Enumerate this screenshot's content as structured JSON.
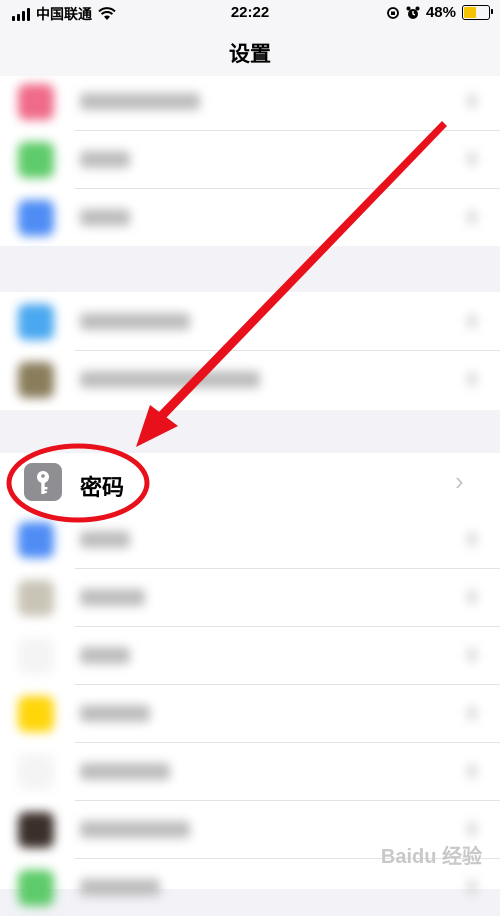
{
  "status_bar": {
    "carrier": "中国联通",
    "time": "22:22",
    "battery": "48%",
    "battery_fraction": 0.48,
    "signal_bars": 4
  },
  "nav": {
    "title": "设置"
  },
  "password_row": {
    "label": "密码",
    "icon": "key-icon",
    "chevron": "›"
  },
  "blurred_rows": [
    {
      "icon_color": "#f06b8a",
      "text_width": 0.24
    },
    {
      "icon_color": "#5ecb6a",
      "text_width": 0.1
    },
    {
      "icon_color": "#4f8df5",
      "text_width": 0.1
    },
    {
      "icon_color": "#4aa8f0",
      "text_width": 0.22
    },
    {
      "icon_color": "#8a7d5c",
      "text_width": 0.36
    },
    {
      "icon_color": "#4f8df5",
      "text_width": 0.1
    },
    {
      "icon_color": "#c9c4b6",
      "text_width": 0.13
    },
    {
      "icon_color": "#f4f4f4",
      "text_width": 0.1
    },
    {
      "icon_color": "#ffd60a",
      "text_width": 0.14
    },
    {
      "icon_color": "#f4f4f4",
      "text_width": 0.18
    },
    {
      "icon_color": "#3a2f2a",
      "text_width": 0.22
    },
    {
      "icon_color": "#5ecb6a",
      "text_width": 0.16
    }
  ],
  "annotation_color": "#e8101a",
  "watermark": "Baidu 经验"
}
